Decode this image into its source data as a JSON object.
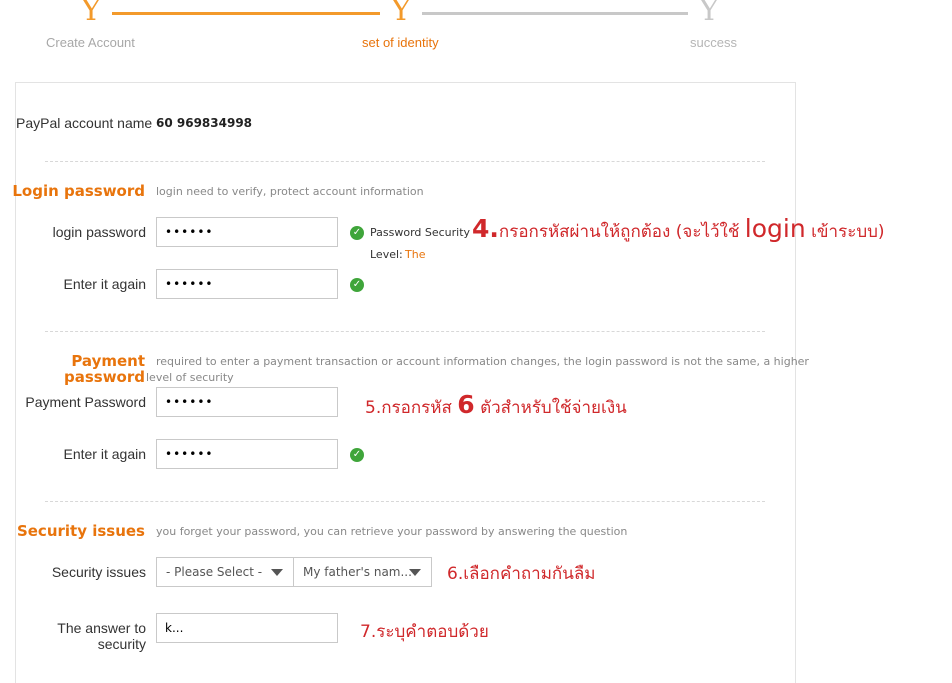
{
  "stepper": {
    "steps": [
      {
        "icon": "Y",
        "label": "Create Account",
        "state": "done"
      },
      {
        "icon": "Y",
        "label": "set of identity",
        "state": "current"
      },
      {
        "icon": "Y",
        "label": "success",
        "state": "pending"
      }
    ],
    "colors": {
      "active": "#f39a2b",
      "inactive": "#c8c8c8",
      "current_label": "#e8740c"
    }
  },
  "account": {
    "label": "PayPal account name",
    "value": "60 969834998"
  },
  "login_section": {
    "title": "Login password",
    "description": "login need to verify, protect account information",
    "password_label": "login password",
    "password_value": "••••••",
    "confirm_label": "Enter it again",
    "confirm_value": "••••••",
    "security_text": "Password Security",
    "level_label": "Level:",
    "level_value": "The",
    "annotation_prefix": "4.",
    "annotation_text": "กรอกรหัสผ่านให้ถูกต้อง (จะไว้ใช้ ",
    "annotation_big": "login",
    "annotation_suffix": " เข้าระบบ)"
  },
  "payment_section": {
    "title_line1": "Payment",
    "title_line2": "password",
    "description_line1": "required to enter a payment transaction or account information changes, the login password is not the same, a higher",
    "description_line2": "level of security",
    "password_label": "Payment Password",
    "password_value": "••••••",
    "confirm_label": "Enter it again",
    "confirm_value": "••••••",
    "annotation_prefix": "5.กรอกรหัส ",
    "annotation_big": "6",
    "annotation_suffix": " ตัวสำหรับใช้จ่ายเงิน"
  },
  "security_section": {
    "title": "Security issues",
    "description": "you forget your password, you can retrieve your password by answering the question",
    "issues_label": "Security issues",
    "select1_value": "- Please Select -",
    "select2_value": "My father's nam...",
    "annotation_select": "6.เลือกคำถามกันลืม",
    "answer_label_line1": "The answer to",
    "answer_label_line2": "security",
    "answer_value": "k...",
    "annotation_answer": "7.ระบุคำตอบด้วย"
  }
}
